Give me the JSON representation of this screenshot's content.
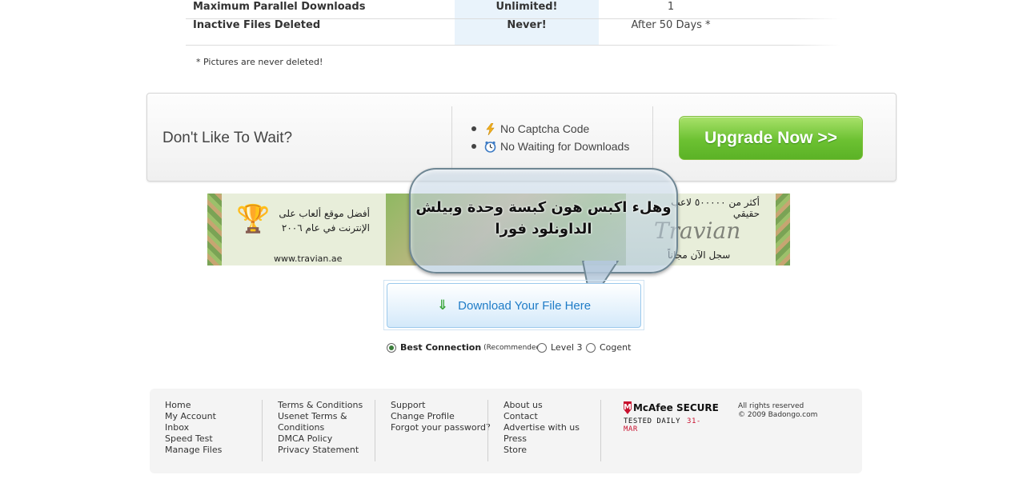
{
  "comparison": {
    "rows": [
      {
        "label": "Maximum Parallel Downloads",
        "premium": "Unlimited!",
        "free": "1"
      },
      {
        "label": "Inactive Files Deleted",
        "premium": "Never!",
        "free": "After 50 Days *"
      }
    ],
    "footnote": "* Pictures are never deleted!"
  },
  "upgrade": {
    "title": "Don't Like To Wait?",
    "features": [
      {
        "icon": "lightning-icon",
        "label": "No Captcha Code"
      },
      {
        "icon": "clock-icon",
        "label": "No Waiting for Downloads"
      }
    ],
    "button_label": "Upgrade Now >>"
  },
  "ad": {
    "text_left": "أفضل موقع ألعاب على الإنترنت في عام ٢٠٠٦",
    "url": "www.travian.ae",
    "text_right_top": "أكثر من ٥٠٠٠٠٠ لاعب حقيقي",
    "logo": "Travian",
    "text_right_bottom": "سجل الآن مجاناً"
  },
  "bubble": {
    "text": "وهلء اكبس هون كبسة وحدة وبيلش الداونلود فورا"
  },
  "download": {
    "label": "Download Your File Here"
  },
  "connection": {
    "options": [
      {
        "label": "Best Connection",
        "note": "(Recommended)",
        "selected": true
      },
      {
        "label": "Level 3",
        "selected": false
      },
      {
        "label": "Cogent",
        "selected": false
      }
    ]
  },
  "footer": {
    "col1": [
      "Home",
      "My Account",
      "Inbox",
      "Speed Test",
      "Manage Files"
    ],
    "col2": [
      "Terms & Conditions",
      "Usenet Terms & Conditions",
      "DMCA Policy",
      "Privacy Statement"
    ],
    "col3": [
      "Support",
      "Change Profile",
      "Forgot your password?"
    ],
    "col4": [
      "About us",
      "Contact",
      "Advertise with us",
      "Press",
      "Store"
    ],
    "mcafee": {
      "brand": "McAfee",
      "secure": "SECURE",
      "tested": "TESTED DAILY",
      "date": "31-MAR"
    },
    "copyright_1": "All rights reserved",
    "copyright_2": "© 2009 Badongo.com"
  },
  "colors": {
    "accent_green": "#6cc132",
    "link_blue": "#1f7cc7",
    "mcafee_red": "#c8102e"
  }
}
